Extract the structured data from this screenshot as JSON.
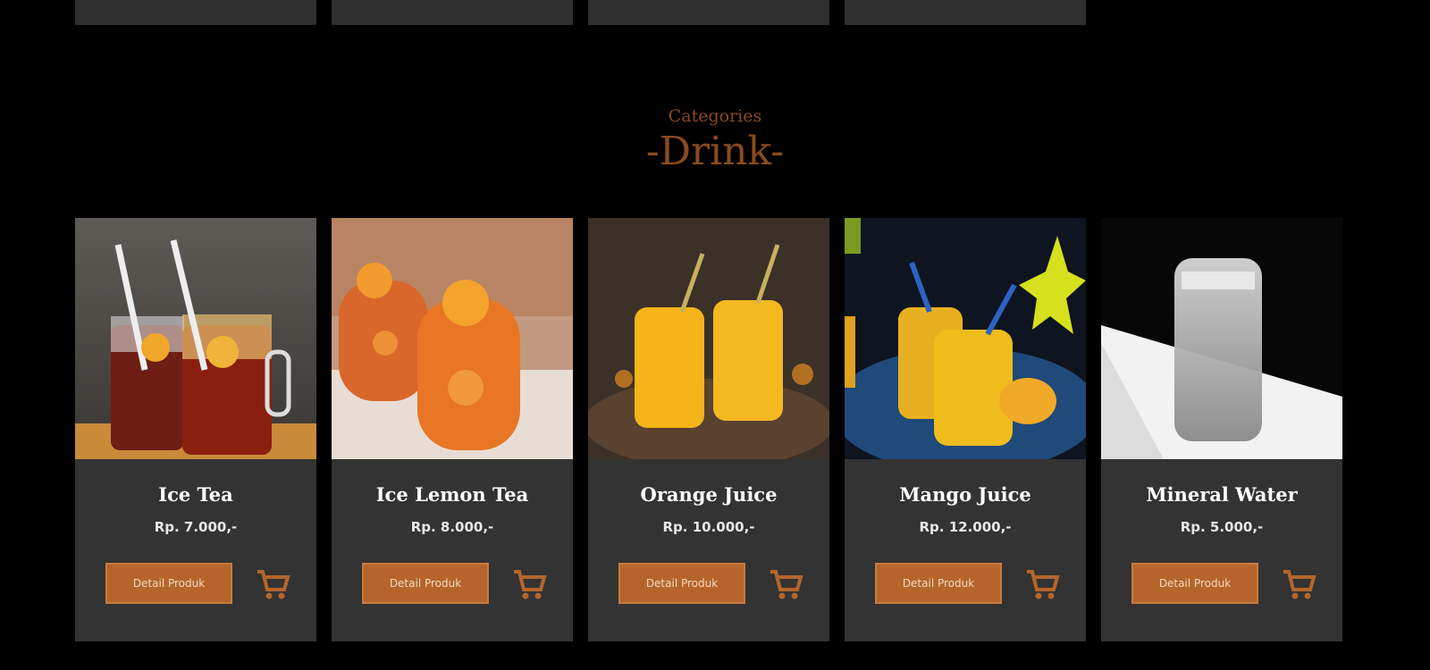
{
  "category": {
    "label": "Categories",
    "name": "-Drink-"
  },
  "products": [
    {
      "name": "Ice Tea",
      "price": "Rp. 7.000,-",
      "button_label": "Detail Produk",
      "cart_icon": "cart-icon",
      "image": "iced tea glasses"
    },
    {
      "name": "Ice Lemon Tea",
      "price": "Rp. 8.000,-",
      "button_label": "Detail Produk",
      "cart_icon": "cart-icon",
      "image": "iced lemon tea glasses"
    },
    {
      "name": "Orange Juice",
      "price": "Rp. 10.000,-",
      "button_label": "Detail Produk",
      "cart_icon": "cart-icon",
      "image": "orange juice jars"
    },
    {
      "name": "Mango Juice",
      "price": "Rp. 12.000,-",
      "button_label": "Detail Produk",
      "cart_icon": "cart-icon",
      "image": "mango juice jars"
    },
    {
      "name": "Mineral Water",
      "price": "Rp. 5.000,-",
      "button_label": "Detail Produk",
      "cart_icon": "cart-icon",
      "image": "glass of water"
    }
  ],
  "colors": {
    "background": "#000000",
    "card": "#333333",
    "accent": "#b5652c",
    "category_text": "#8b4a1e"
  }
}
